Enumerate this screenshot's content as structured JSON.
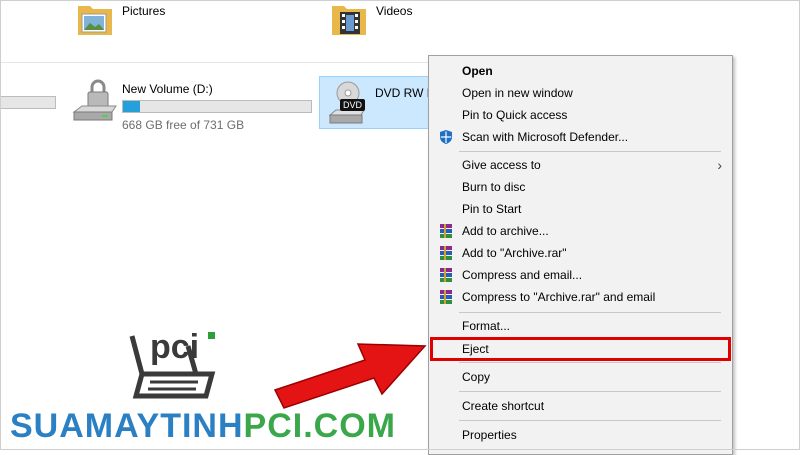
{
  "folders": [
    {
      "label": "Pictures",
      "icon": "pictures-folder-icon"
    },
    {
      "label": "Videos",
      "icon": "videos-folder-icon"
    }
  ],
  "drives": [
    {
      "name": "New Volume (D:)",
      "free_text": "668 GB free of 731 GB",
      "used_fraction": 0.09,
      "icon": "locked-drive-icon"
    },
    {
      "name": "DVD RW D",
      "icon": "dvd-drive-icon",
      "badge": "DVD",
      "selected": true
    }
  ],
  "context_menu": {
    "items": [
      {
        "label": "Open",
        "bold": true
      },
      {
        "label": "Open in new window"
      },
      {
        "label": "Pin to Quick access"
      },
      {
        "label": "Scan with Microsoft Defender...",
        "icon": "defender-shield-icon"
      },
      {
        "label": "Give access to",
        "submenu": true
      },
      {
        "label": "Burn to disc"
      },
      {
        "label": "Pin to Start"
      },
      {
        "label": "Add to archive...",
        "icon": "winrar-icon"
      },
      {
        "label": "Add to \"Archive.rar\"",
        "icon": "winrar-icon"
      },
      {
        "label": "Compress and email...",
        "icon": "winrar-icon"
      },
      {
        "label": "Compress to \"Archive.rar\" and email",
        "icon": "winrar-icon"
      },
      {
        "label": "Format..."
      },
      {
        "label": "Eject",
        "highlighted": true
      },
      {
        "label": "Copy"
      },
      {
        "label": "Create shortcut"
      },
      {
        "label": "Properties"
      }
    ],
    "submenu_arrow": "›"
  },
  "logo": {
    "text": "pci"
  },
  "watermark": {
    "part1": "SUAMAYTINH",
    "part2": "PCI.COM"
  },
  "colors": {
    "accent": "#26a0da",
    "highlight": "#e10000",
    "selection": "#cce8ff",
    "wm_blue": "#2b7fc3",
    "wm_green": "#39a74a"
  }
}
